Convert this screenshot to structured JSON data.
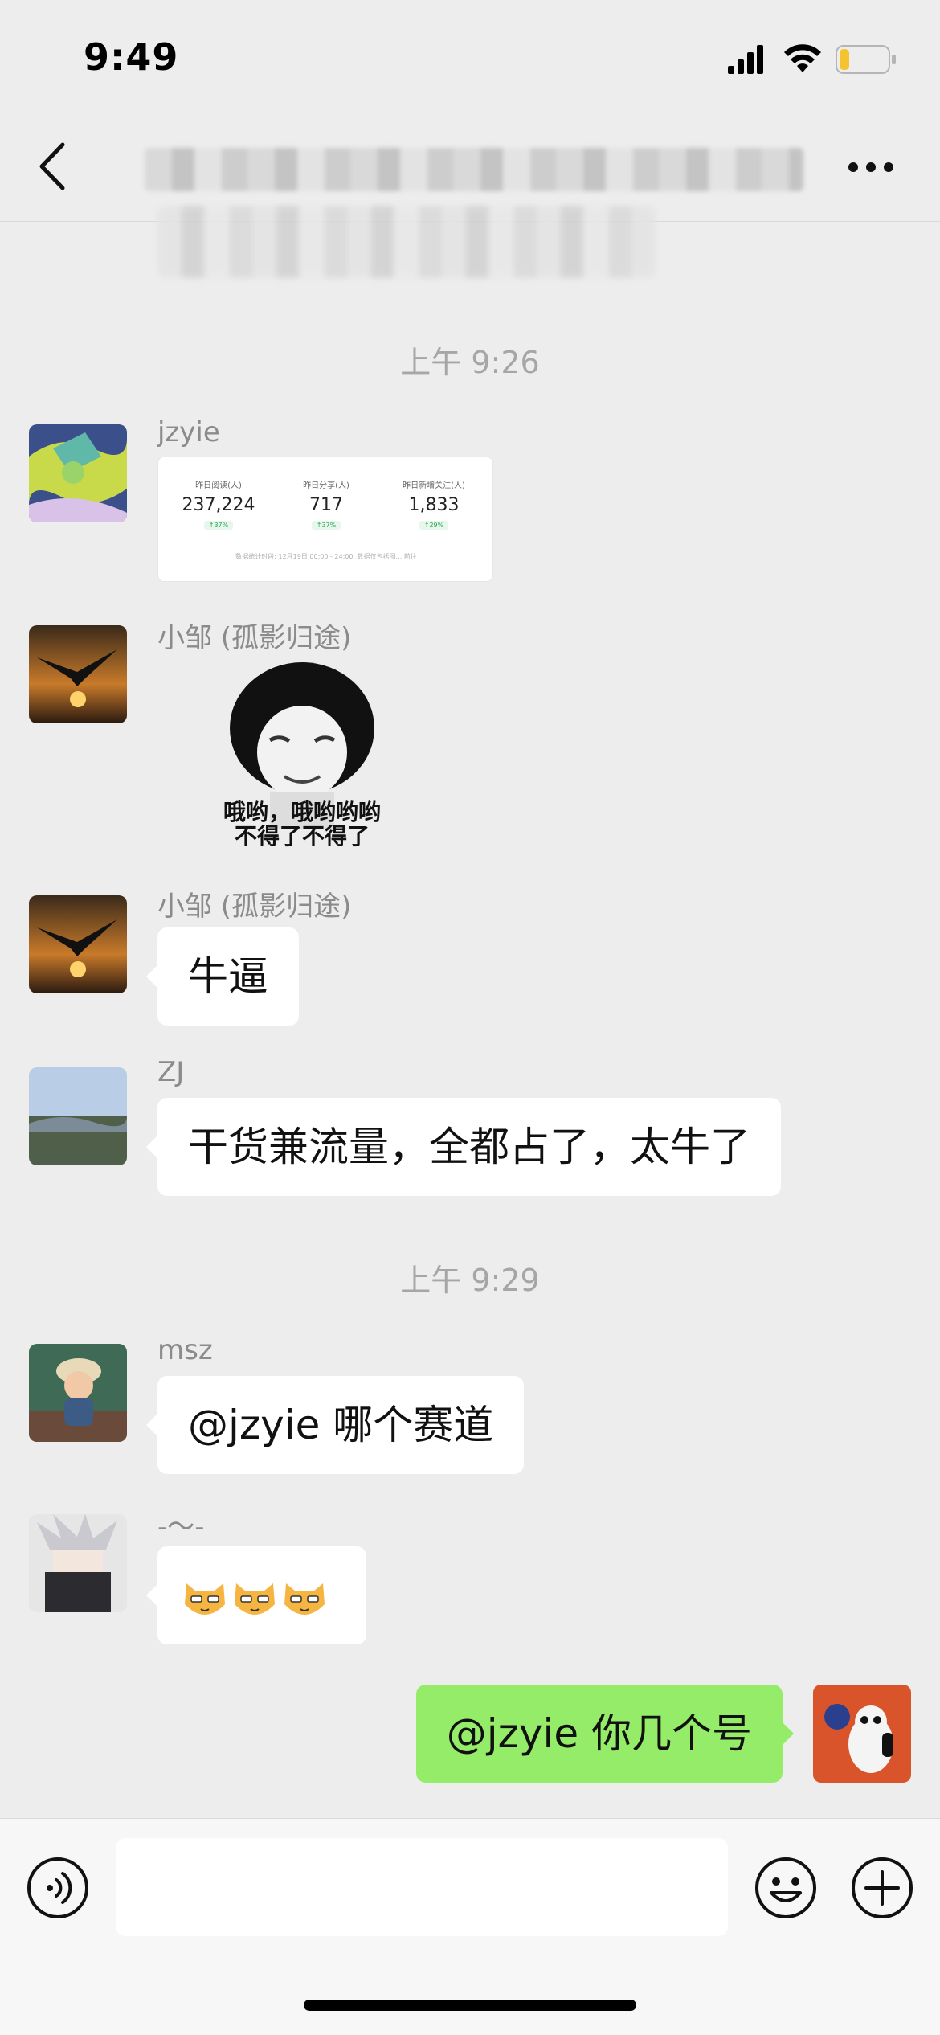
{
  "status_bar": {
    "time": "9:49"
  },
  "messages_section": {
    "timestamp_1": "上午 9:26",
    "timestamp_2": "上午 9:29"
  },
  "messages": {
    "m1": {
      "sender": "jzyie",
      "stats": {
        "items": [
          {
            "label": "昨日阅读(人)",
            "value": "237,224",
            "change": "↑37%"
          },
          {
            "label": "昨日分享(人)",
            "value": "717",
            "change": "↑37%"
          },
          {
            "label": "昨日新增关注(人)",
            "value": "1,833",
            "change": "↑29%"
          }
        ],
        "footnote": "数据统计时段: 12月19日 00:00 - 24:00, 数据仅包括图... 前往"
      }
    },
    "m2": {
      "sender": "小邹 (孤影归途)",
      "sticker_caption_line1": "哦哟，哦哟哟哟",
      "sticker_caption_line2": "不得了不得了"
    },
    "m3": {
      "sender": "小邹 (孤影归途)",
      "text": "牛逼"
    },
    "m4": {
      "sender": "ZJ",
      "text": "干货兼流量，全都占了，太牛了"
    },
    "m5": {
      "sender": "msz",
      "text": "@jzyie 哪个赛道"
    },
    "m6": {
      "sender": "-～-",
      "emoji_count": 3
    },
    "m7": {
      "text": "@jzyie 你几个号"
    }
  },
  "input_bar": {
    "placeholder": ""
  },
  "colors": {
    "background": "#ededed",
    "my_bubble": "#95ec69",
    "their_bubble": "#ffffff",
    "battery_level": "#f4c430"
  },
  "battery_level": 0.18
}
